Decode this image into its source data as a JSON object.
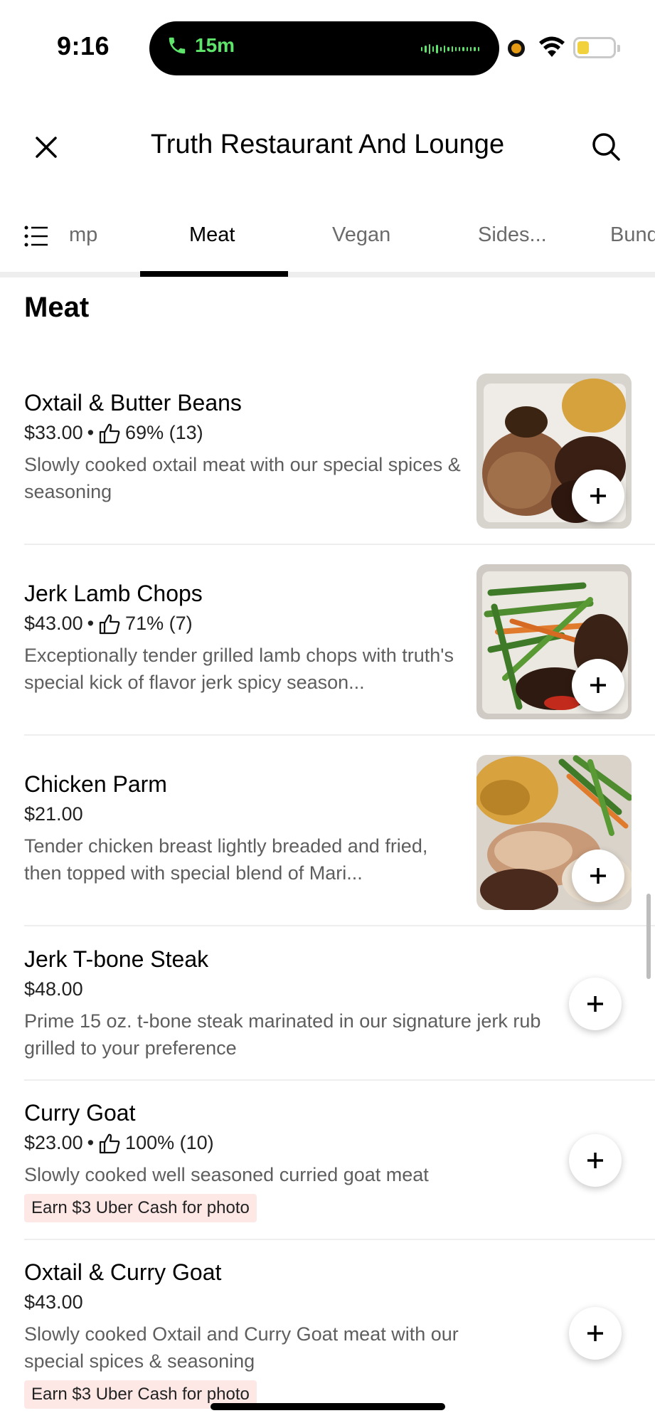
{
  "status_bar": {
    "time": "9:16",
    "call_duration": "15m",
    "icons": [
      "phone-icon",
      "waveform-icon",
      "recording-dot-icon",
      "wifi-icon",
      "battery-icon"
    ],
    "colors": {
      "call": "#5ee36b",
      "battery": "#f2d23c",
      "recording": "#e49a13"
    }
  },
  "header": {
    "title": "Truth Restaurant And Lounge",
    "icons": [
      "close-icon",
      "search-icon"
    ]
  },
  "tabs": [
    {
      "label": "mp",
      "active": false
    },
    {
      "label": "Meat",
      "active": true
    },
    {
      "label": "Vegan",
      "active": false
    },
    {
      "label": "Sides...",
      "active": false
    },
    {
      "label": "Bund",
      "active": false
    }
  ],
  "section": {
    "title": "Meat"
  },
  "items": [
    {
      "name": "Oxtail & Butter Beans",
      "price": "$33.00",
      "rating": "69% (13)",
      "description": "Slowly cooked oxtail meat with our special spices & seasoning",
      "has_photo": true
    },
    {
      "name": "Jerk Lamb Chops",
      "price": "$43.00",
      "rating": "71% (7)",
      "description": "Exceptionally tender grilled lamb chops with truth's special kick of flavor jerk spicy season...",
      "has_photo": true
    },
    {
      "name": "Chicken Parm",
      "price": "$21.00",
      "rating": "",
      "description": "Tender chicken breast lightly breaded and fried, then topped with special blend of Mari...",
      "has_photo": true
    },
    {
      "name": "Jerk T-bone Steak",
      "price": "$48.00",
      "rating": "",
      "description": "Prime 15 oz. t-bone steak marinated in our signature jerk rub grilled to your preference",
      "has_photo": false
    },
    {
      "name": "Curry Goat",
      "price": "$23.00",
      "rating": "100% (10)",
      "description": "Slowly cooked well seasoned curried goat meat",
      "promo": "Earn $3 Uber Cash for photo",
      "has_photo": false
    },
    {
      "name": "Oxtail & Curry Goat",
      "price": "$43.00",
      "rating": "",
      "description": "Slowly cooked Oxtail and Curry Goat meat with our special spices & seasoning",
      "promo": "Earn $3 Uber Cash for photo",
      "has_photo": false
    }
  ],
  "separator": "•"
}
